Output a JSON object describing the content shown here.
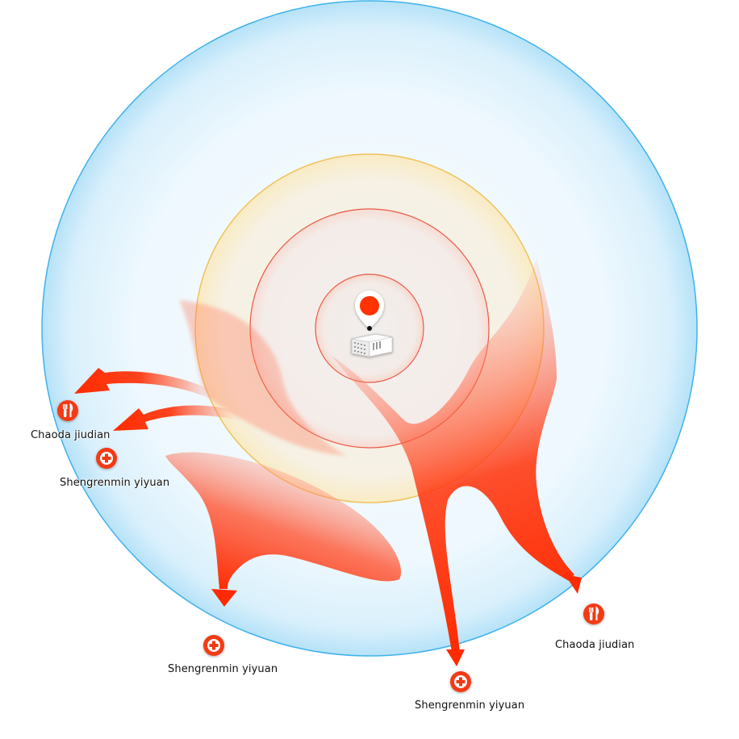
{
  "colors": {
    "outer_ring_stroke": "#3fb2ec",
    "outer_ring_fill": "#e6f5fd",
    "yellow_ring": "#f0c15a",
    "red_ring": "#ea5a45",
    "flow_red": "#ff2a00",
    "pin_red": "#ff3300",
    "poi_red": "#f23a14"
  },
  "center": {
    "pin_icon": "map-pin-icon",
    "building_icon": "office-building-icon"
  },
  "pois": [
    {
      "icon": "restaurant-icon",
      "label": "Chaoda jiudian"
    },
    {
      "icon": "hospital-cross-icon",
      "label": "Shengrenmin  yiyuan"
    },
    {
      "icon": "hospital-cross-icon",
      "label": "Shengrenmin  yiyuan"
    },
    {
      "icon": "hospital-cross-icon",
      "label": "Shengrenmin  yiyuan"
    },
    {
      "icon": "restaurant-icon",
      "label": "Chaoda jiudian"
    }
  ]
}
